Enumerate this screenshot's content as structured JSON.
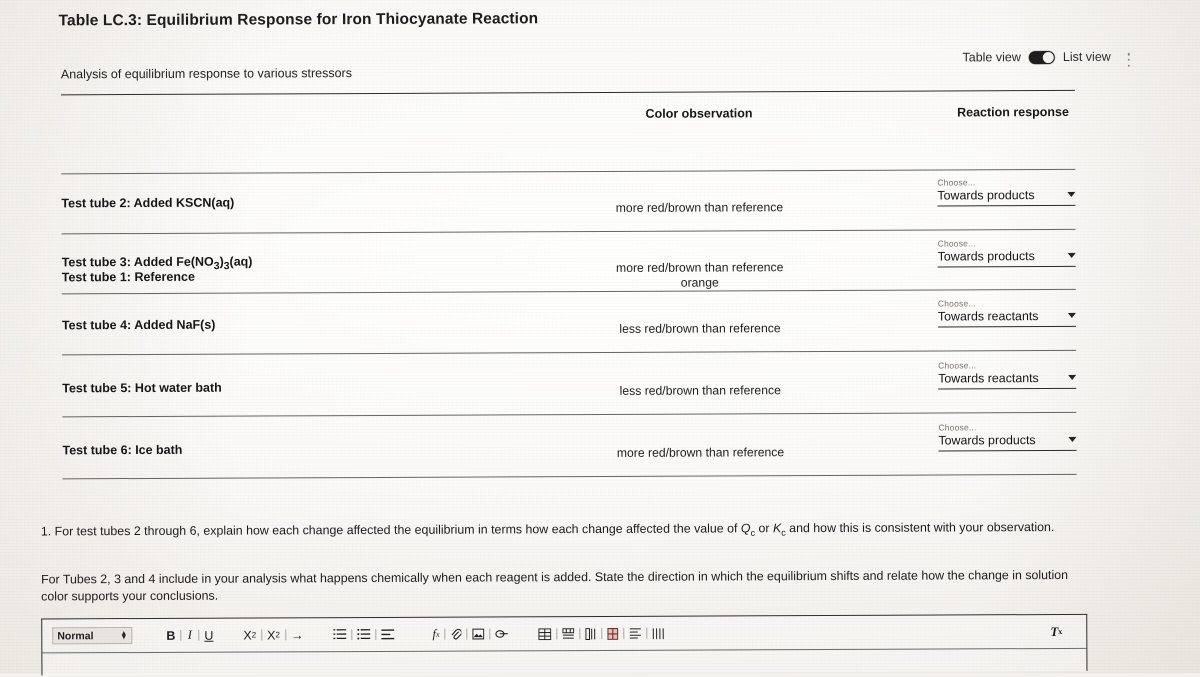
{
  "document": {
    "title_prefix": "Table LC.3: Equilibrium Response for Iron Thiocyanate Reaction",
    "caption": "Analysis of equilibrium response to various stressors"
  },
  "view_controls": {
    "table_view_label": "Table view",
    "list_view_label": "List view",
    "toggle_state": "list",
    "overflow_menu": "⋮"
  },
  "table": {
    "headers": [
      "",
      "Color observation",
      "Reaction response"
    ],
    "choose_label": "Choose...",
    "rows": [
      {
        "label": "Test tube 1: Reference",
        "observation": "orange",
        "response": null
      },
      {
        "label": "Test tube 2: Added KSCN(aq)",
        "observation": "more red/brown than reference",
        "response": "Towards products"
      },
      {
        "label": "Test tube 3: Added Fe(NO3)3(aq)",
        "label_html": "Test tube 3: Added Fe(NO<sub>3</sub>)<sub>3</sub>(aq)",
        "observation": "more red/brown than reference",
        "response": "Towards products"
      },
      {
        "label": "Test tube 4: Added NaF(s)",
        "observation": "less red/brown than reference",
        "response": "Towards reactants"
      },
      {
        "label": "Test tube 5: Hot water bath",
        "observation": "less red/brown than reference",
        "response": "Towards reactants"
      },
      {
        "label": "Test tube 6: Ice bath",
        "observation": "more red/brown than reference",
        "response": "Towards products"
      }
    ]
  },
  "questions": {
    "q1": "1. For test tubes 2 through 6, explain how each change affected the equilibrium in terms how each change affected the value of Qc or Kc and how this is consistent with your observation.",
    "q1_html": "1. For test tubes 2 through 6, explain how each change affected the equilibrium in terms how each change affected the value of <em>Q</em><sub>c</sub> or <em>K</em><sub>c</sub> and how this is consistent with your observation.",
    "q2": "For Tubes 2, 3 and 4 include in your analysis what happens chemically when each reagent is added. State the direction in which the equilibrium shifts and relate how the change in solution color supports your conclusions."
  },
  "editor": {
    "style_value": "Normal",
    "buttons": [
      {
        "name": "bold",
        "glyph": "B"
      },
      {
        "name": "italic",
        "glyph": "I"
      },
      {
        "name": "underline",
        "glyph": "U"
      },
      {
        "name": "subscript",
        "glyph": "X₂"
      },
      {
        "name": "superscript",
        "glyph": "X²"
      },
      {
        "name": "arrow",
        "glyph": "→"
      },
      {
        "name": "numbered-list",
        "glyph": "☰"
      },
      {
        "name": "bulleted-list",
        "glyph": "☰"
      },
      {
        "name": "align",
        "glyph": "☰"
      },
      {
        "name": "formula",
        "glyph": "fx"
      },
      {
        "name": "attachment",
        "glyph": "📎"
      },
      {
        "name": "image",
        "glyph": "❑"
      },
      {
        "name": "link",
        "glyph": "∞"
      },
      {
        "name": "insert-table",
        "glyph": "⊞"
      },
      {
        "name": "table-row",
        "glyph": "≡"
      },
      {
        "name": "table-column",
        "glyph": "‖"
      },
      {
        "name": "table-cell",
        "glyph": "▤"
      },
      {
        "name": "table-properties",
        "glyph": "≣"
      },
      {
        "name": "table-merge",
        "glyph": "Ⅱ"
      }
    ],
    "clear_formatting": "Tx"
  },
  "colors": {
    "ink": "#1b1b1b",
    "rule": "#2b2b2b",
    "muted_label": "#7a756e",
    "toggle_on": "#1d1d1d",
    "paper": "#fbfaf8"
  }
}
